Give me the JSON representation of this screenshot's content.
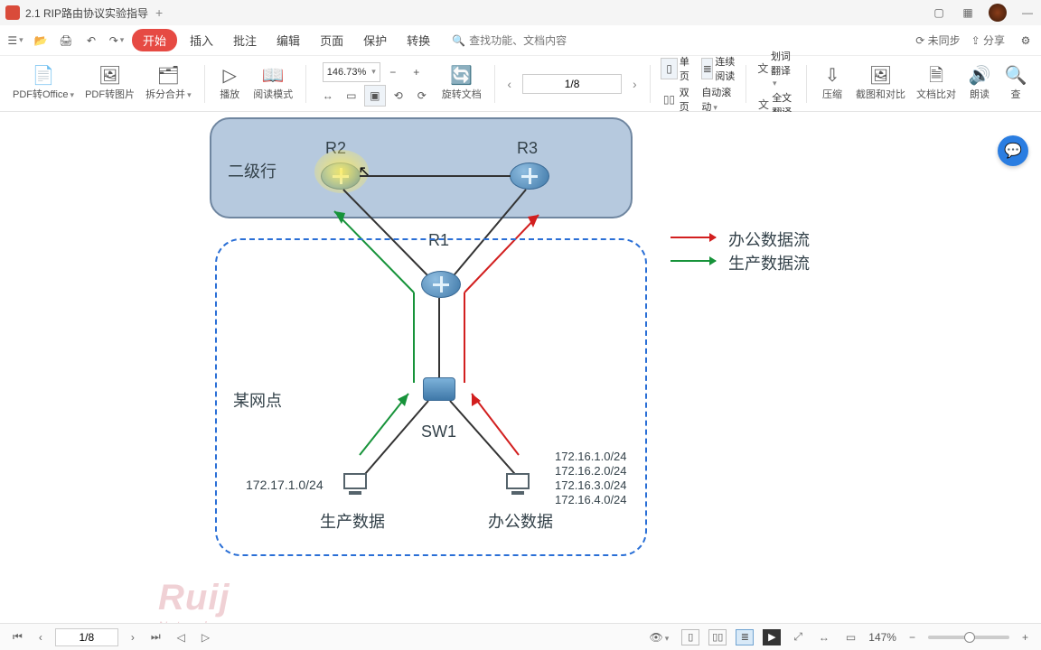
{
  "titlebar": {
    "doc_name": "2.1 RIP路由协议实验指导"
  },
  "menu": {
    "start": "开始",
    "items": [
      "插入",
      "批注",
      "编辑",
      "页面",
      "保护",
      "转换"
    ],
    "search_placeholder": "查找功能、文档内容",
    "sync": "未同步",
    "share": "分享"
  },
  "ribbon": {
    "pdf_to_office": "PDF转Office",
    "pdf_to_image": "PDF转图片",
    "split_merge": "拆分合并",
    "play": "播放",
    "read_mode": "阅读模式",
    "zoom": "146.73%",
    "rotate": "旋转文档",
    "single": "单页",
    "double": "双页",
    "continuous": "连续阅读",
    "auto_scroll": "自动滚动",
    "word_trans": "划词翻译",
    "full_trans": "全文翻译",
    "compress": "压缩",
    "screenshot_compare": "截图和对比",
    "doc_compare": "文档比对",
    "read_aloud": "朗读",
    "find": "查",
    "page": "1/8"
  },
  "diagram": {
    "top_label": "二级行",
    "r1": "R1",
    "r2": "R2",
    "r3": "R3",
    "sw1": "SW1",
    "site_label": "某网点",
    "prod_label": "生产数据",
    "office_label": "办公数据",
    "legend_office": "办公数据流",
    "legend_prod": "生产数据流",
    "prod_net": "172.17.1.0/24",
    "nets": [
      "172.16.1.0/24",
      "172.16.2.0/24",
      "172.16.3.0/24",
      "172.16.4.0/24"
    ]
  },
  "watermark": {
    "brand": "Ruij",
    "sub": "Networks"
  },
  "status": {
    "page": "1/8",
    "zoom": "147%"
  }
}
